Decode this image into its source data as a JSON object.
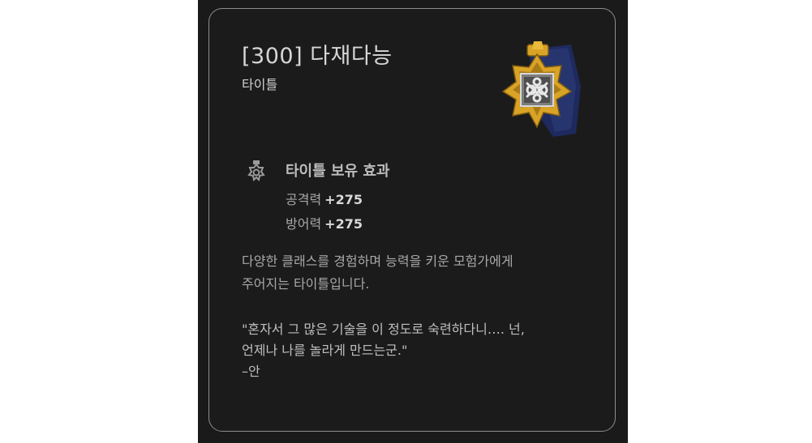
{
  "tooltip": {
    "title": "[300] 다재다능",
    "category": "타이틀",
    "emblem_icon": "knot-medal-icon",
    "effect": {
      "icon": "medal-icon",
      "heading": "타이틀 보유 효과",
      "stats": [
        {
          "name": "공격력",
          "value": "+275"
        },
        {
          "name": "방어력",
          "value": "+275"
        }
      ]
    },
    "description_lines": [
      "다양한 클래스를 경험하며 능력을 키운 모험가에게",
      "주어지는 타이틀입니다."
    ],
    "quote_lines": [
      "\"혼자서 그 많은 기술을 이 정도로 숙련하다니…. 넌,",
      "언제나 나를 놀라게 만드는군.\"",
      "–안"
    ]
  },
  "colors": {
    "panel_background": "#1b1b1b",
    "panel_border": "#8d8d8d",
    "emblem_gold": "#d9a326",
    "emblem_navy": "#1e2a5e"
  }
}
